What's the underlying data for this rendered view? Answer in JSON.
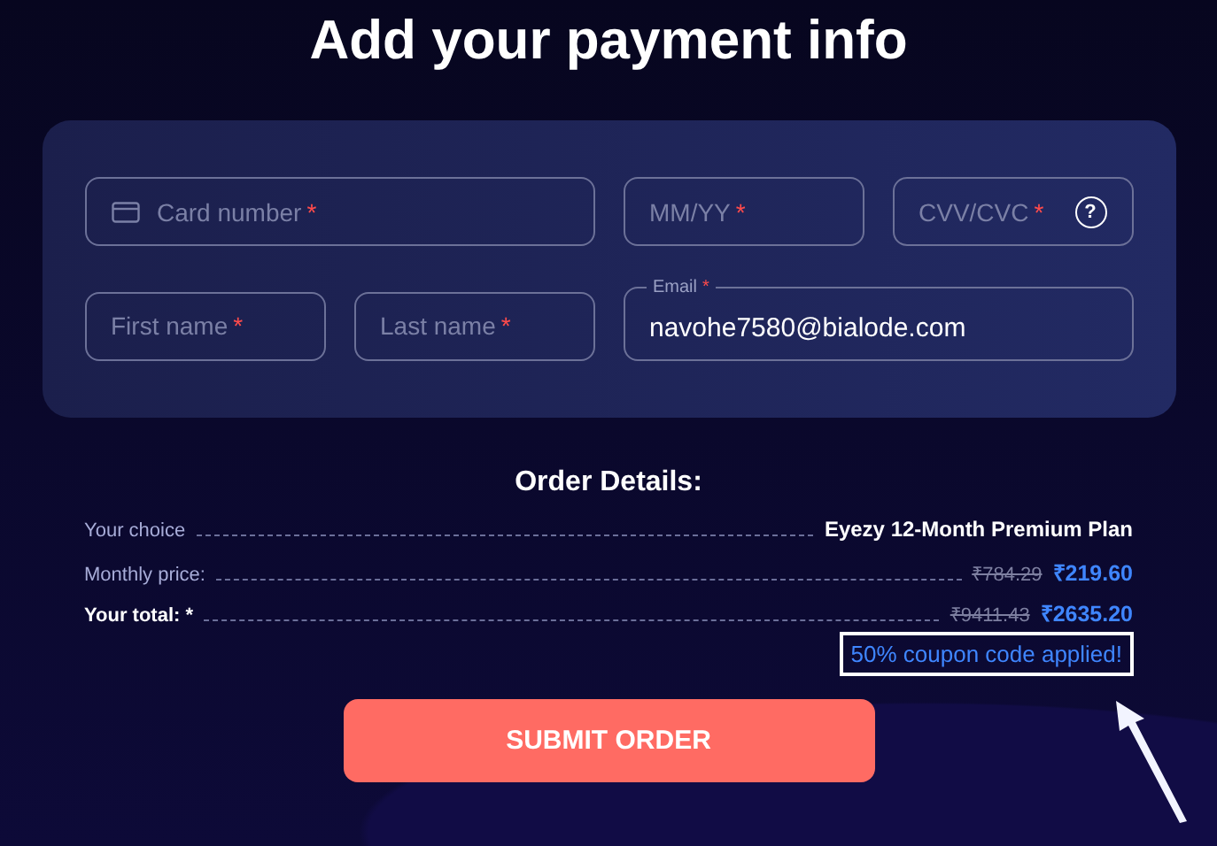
{
  "title": "Add your payment info",
  "fields": [
    {
      "kind": "card",
      "label": "Card number",
      "mark": "*"
    },
    {
      "kind": "plain",
      "label": "MM/YY",
      "mark": "*"
    },
    {
      "kind": "cvv",
      "label": "CVV/CVC",
      "mark": "*",
      "help": "?"
    },
    {
      "kind": "plain",
      "label": "First name",
      "mark": "*"
    },
    {
      "kind": "plain",
      "label": "Last name",
      "mark": "*"
    },
    {
      "kind": "filled",
      "label": "Email",
      "mark": "*",
      "value": "navohe7580@bialode.com"
    }
  ],
  "order": {
    "title": "Order Details:",
    "rows": [
      {
        "label": "Your choice",
        "emphasis": false,
        "value": "Eyezy 12-Month Premium Plan"
      },
      {
        "label": "Monthly price:",
        "emphasis": false,
        "old_price": "₹784.29",
        "new_price": "₹219.60"
      },
      {
        "label": "Your total: *",
        "emphasis": true,
        "old_price": "₹9411.43",
        "new_price": "₹2635.20"
      }
    ],
    "coupon": "50% coupon code applied!"
  },
  "submit": "SUBMIT ORDER"
}
